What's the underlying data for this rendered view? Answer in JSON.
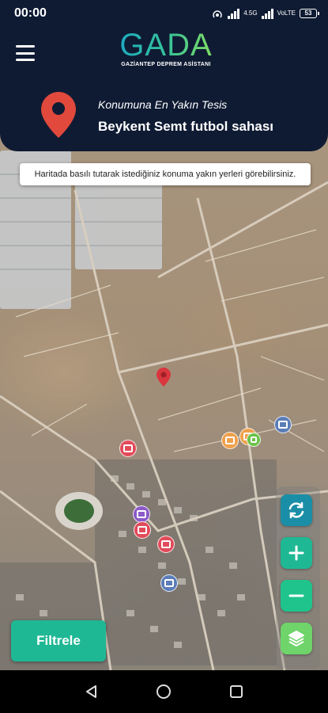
{
  "status_bar": {
    "time": "00:00",
    "net_small_1": "4.5G",
    "net_small_2": "VoLTE",
    "battery": "53"
  },
  "header": {
    "logo_text": "GADA",
    "logo_subtitle": "GAZİANTEP DEPREM ASİSTANI",
    "nearest_label": "Konumuna En Yakın Tesis",
    "nearest_name": "Beykent Semt futbol sahası"
  },
  "map": {
    "hint": "Haritada basılı tutarak istediğiniz konuma yakın yerleri görebilirsiniz.",
    "markers": [
      {
        "name": "marker-hospital-1",
        "color": "#e24b5a"
      },
      {
        "name": "marker-orange-1",
        "color": "#f0a04b"
      },
      {
        "name": "marker-orange-2",
        "color": "#f0a04b"
      },
      {
        "name": "marker-green-1",
        "color": "#6cc24a"
      },
      {
        "name": "marker-school-1",
        "color": "#5b7db8"
      },
      {
        "name": "marker-purple-1",
        "color": "#8c5ac8"
      },
      {
        "name": "marker-hospital-2",
        "color": "#e24b5a"
      },
      {
        "name": "marker-hospital-3",
        "color": "#e24b5a"
      },
      {
        "name": "marker-school-2",
        "color": "#5b7db8"
      }
    ]
  },
  "controls": {
    "refresh_color": "#1a8ea6",
    "zoom_in_color": "#1fb894",
    "zoom_out_color": "#1fc48c",
    "layers_color": "#6fd46a"
  },
  "filter": {
    "label": "Filtrele",
    "color": "#1fb894"
  },
  "navbar": {
    "back_icon": "back-triangle-icon",
    "home_icon": "home-circle-icon",
    "recents_icon": "recents-square-icon"
  }
}
